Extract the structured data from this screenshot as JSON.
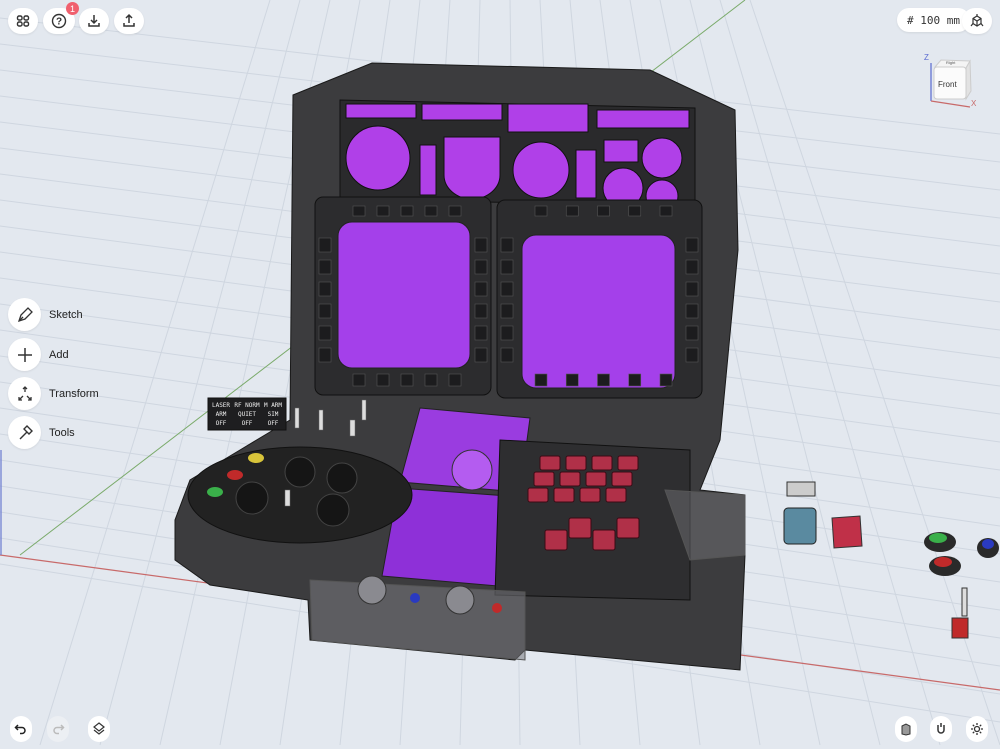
{
  "toolbar": {
    "help_badge": "1",
    "scale_label": "# 100 mm"
  },
  "viewcube": {
    "face": "Front",
    "top_face": "Right",
    "axis_z": "Z",
    "axis_x": "X"
  },
  "side_menu": [
    {
      "label": "Sketch",
      "icon": "pen-icon"
    },
    {
      "label": "Add",
      "icon": "plus-icon"
    },
    {
      "label": "Transform",
      "icon": "transform-icon"
    },
    {
      "label": "Tools",
      "icon": "hammer-icon"
    }
  ],
  "model": {
    "switch_labels": [
      {
        "top": "LASER",
        "mid": "ARM",
        "bot": "OFF"
      },
      {
        "top": "RF NORM",
        "mid": "QUIET",
        "bot": "OFF"
      },
      {
        "top": "M ARM",
        "mid": "SIM",
        "bot": "OFF"
      }
    ]
  },
  "colors": {
    "background": "#e3e8ef",
    "housing": "#3a3a3a",
    "screen": "#a040e0",
    "key_red": "#b03048",
    "badge": "#f0606e"
  }
}
